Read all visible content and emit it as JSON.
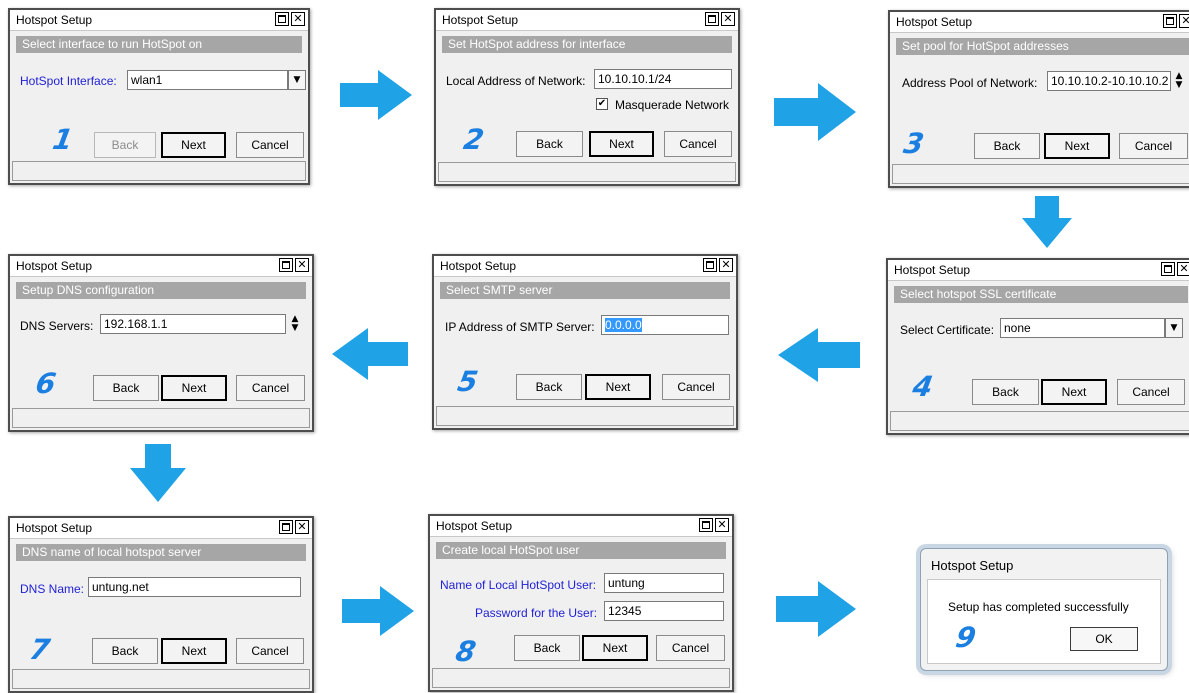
{
  "colors": {
    "arrow": "#1fa2e6",
    "step_number": "#1a7fe0",
    "heading_bg": "#a6a6a6",
    "blue_label": "#1f1fd6"
  },
  "windows": [
    {
      "number": "1",
      "title": "Hotspot Setup",
      "heading": "Select interface to run HotSpot on",
      "fields": [
        {
          "label": "HotSpot Interface:",
          "value": "wlan1"
        }
      ],
      "buttons": {
        "back": "Back",
        "next": "Next",
        "cancel": "Cancel"
      }
    },
    {
      "number": "2",
      "title": "Hotspot Setup",
      "heading": "Set HotSpot address for interface",
      "fields": [
        {
          "label": "Local Address of Network:",
          "value": "10.10.10.1/24"
        }
      ],
      "checkbox": {
        "label": "Masquerade Network",
        "checked": true,
        "mark": "✔"
      },
      "buttons": {
        "back": "Back",
        "next": "Next",
        "cancel": "Cancel"
      }
    },
    {
      "number": "3",
      "title": "Hotspot Setup",
      "heading": "Set pool for HotSpot addresses",
      "fields": [
        {
          "label": "Address Pool of Network:",
          "value": "10.10.10.2-10.10.10.2"
        }
      ],
      "buttons": {
        "back": "Back",
        "next": "Next",
        "cancel": "Cancel"
      }
    },
    {
      "number": "4",
      "title": "Hotspot Setup",
      "heading": "Select hotspot SSL certificate",
      "fields": [
        {
          "label": "Select Certificate:",
          "value": "none"
        }
      ],
      "buttons": {
        "back": "Back",
        "next": "Next",
        "cancel": "Cancel"
      }
    },
    {
      "number": "5",
      "title": "Hotspot Setup",
      "heading": "Select SMTP server",
      "fields": [
        {
          "label": "IP Address of SMTP Server:",
          "value": "0.0.0.0"
        }
      ],
      "buttons": {
        "back": "Back",
        "next": "Next",
        "cancel": "Cancel"
      }
    },
    {
      "number": "6",
      "title": "Hotspot Setup",
      "heading": "Setup DNS configuration",
      "fields": [
        {
          "label": "DNS Servers:",
          "value": "192.168.1.1"
        }
      ],
      "buttons": {
        "back": "Back",
        "next": "Next",
        "cancel": "Cancel"
      }
    },
    {
      "number": "7",
      "title": "Hotspot Setup",
      "heading": "DNS name of local hotspot server",
      "fields": [
        {
          "label": "DNS Name:",
          "value": "untung.net"
        }
      ],
      "buttons": {
        "back": "Back",
        "next": "Next",
        "cancel": "Cancel"
      }
    },
    {
      "number": "8",
      "title": "Hotspot Setup",
      "heading": "Create local HotSpot user",
      "fields": [
        {
          "label": "Name of Local HotSpot User:",
          "value": "untung"
        },
        {
          "label": "Password for the User:",
          "value": "12345"
        }
      ],
      "buttons": {
        "back": "Back",
        "next": "Next",
        "cancel": "Cancel"
      }
    }
  ],
  "final_dialog": {
    "number": "9",
    "title": "Hotspot Setup",
    "message": "Setup has completed successfully",
    "ok_label": "OK"
  },
  "icons": {
    "dropdown": "▼",
    "spin_up": "▲",
    "spin_down": "▼",
    "arrow": "right-arrow-icon"
  }
}
